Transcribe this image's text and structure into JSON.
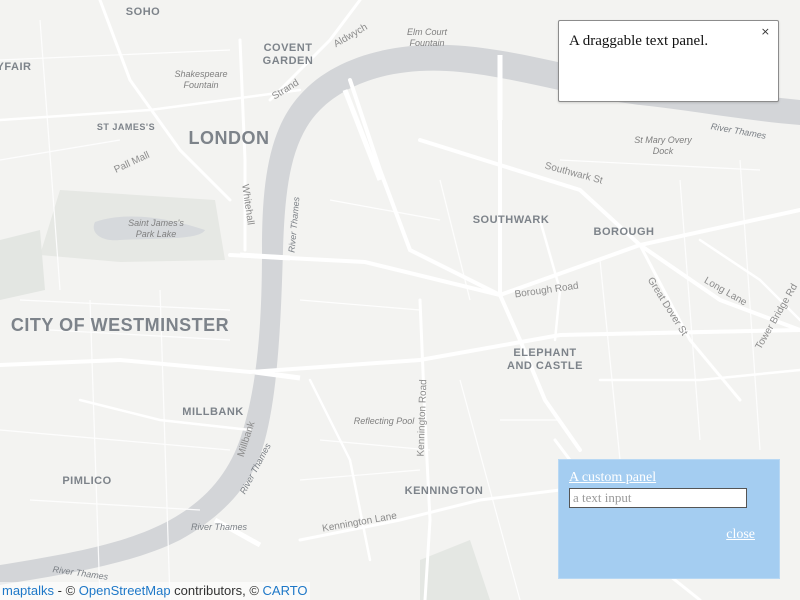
{
  "map": {
    "labels": {
      "soho": "SOHO",
      "mayfair": "YFAIR",
      "covent_garden_1": "COVENT",
      "covent_garden_2": "GARDEN",
      "elm_court_1": "Elm Court",
      "elm_court_2": "Fountain",
      "aldwych": "Aldwych",
      "shakespeare_1": "Shakespeare",
      "shakespeare_2": "Fountain",
      "strand": "Strand",
      "st_james": "ST JAMES'S",
      "london": "LONDON",
      "pall_mall": "Pall Mall",
      "whitehall": "Whitehall",
      "st_james_park_1": "Saint James's",
      "st_james_park_2": "Park Lake",
      "river_thames_1": "River Thames",
      "river_thames_2": "River Thames",
      "river_thames_3": "River Thames",
      "river_thames_4": "River Thames",
      "river_thames_5": "River Thames",
      "st_mary_overy_1": "St Mary Overy",
      "st_mary_overy_2": "Dock",
      "southwark_st": "Southwark St",
      "southwark": "SOUTHWARK",
      "borough": "BOROUGH",
      "westminster": "CITY OF WESTMINSTER",
      "borough_road": "Borough Road",
      "great_dover": "Great Dover St",
      "long_lane": "Long Lane",
      "tower_bridge": "Tower Bridge Rd",
      "elephant_1": "ELEPHANT",
      "elephant_2": "AND CASTLE",
      "millbank_area": "MILLBANK",
      "millbank_st": "Millbank",
      "reflecting_pool": "Reflecting Pool",
      "kennington_road": "Kennington Road",
      "pimlico": "PIMLICO",
      "kennington": "KENNINGTON",
      "kennington_lane": "Kennington Lane"
    }
  },
  "drag_panel": {
    "text": "A draggable text panel.",
    "close_symbol": "×"
  },
  "custom_panel": {
    "title": "A custom panel",
    "input_placeholder": "a text input",
    "close_label": "close"
  },
  "attribution": {
    "maptalks": "maptalks",
    "sep1": " - © ",
    "osm": "OpenStreetMap",
    "contributors": " contributors, © ",
    "carto": "CARTO"
  }
}
